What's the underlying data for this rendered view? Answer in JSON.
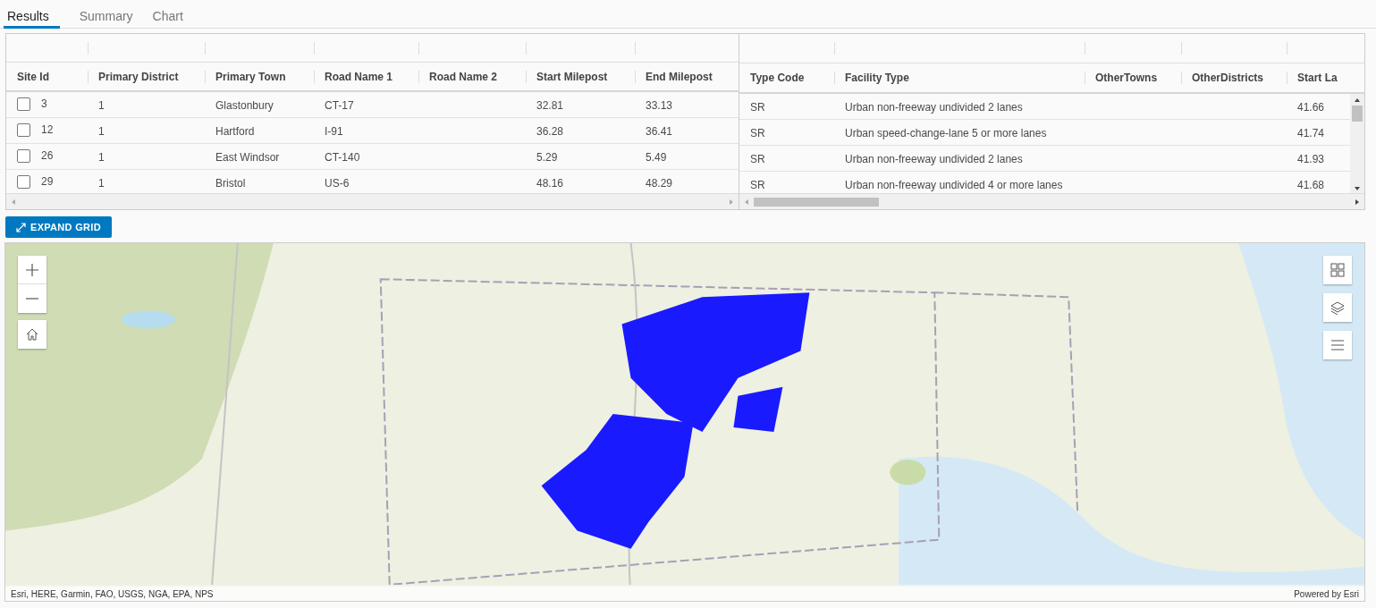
{
  "tabs": [
    {
      "label": "Results",
      "selected": true
    },
    {
      "label": "Summary",
      "selected": false
    },
    {
      "label": "Chart",
      "selected": false
    }
  ],
  "grid": {
    "left_columns": [
      "Site Id",
      "Primary District",
      "Primary Town",
      "Road Name 1",
      "Road Name 2",
      "Start Milepost",
      "End Milepost"
    ],
    "right_columns": [
      "Type Code",
      "Facility Type",
      "OtherTowns",
      "OtherDistricts",
      "Start La"
    ],
    "rows": [
      {
        "checked": false,
        "site_id": "3",
        "primary_district": "1",
        "primary_town": "Glastonbury",
        "road_name_1": "CT-17",
        "start_milepost": "32.81",
        "end_milepost": "33.13",
        "type_code": "SR",
        "facility_type": "Urban non-freeway undivided 2 lanes",
        "start_la": "41.66"
      },
      {
        "checked": false,
        "site_id": "12",
        "primary_district": "1",
        "primary_town": "Hartford",
        "road_name_1": "I-91",
        "start_milepost": "36.28",
        "end_milepost": "36.41",
        "type_code": "SR",
        "facility_type": "Urban speed-change-lane 5 or more lanes",
        "start_la": "41.74"
      },
      {
        "checked": false,
        "site_id": "26",
        "primary_district": "1",
        "primary_town": "East Windsor",
        "road_name_1": "CT-140",
        "start_milepost": "5.29",
        "end_milepost": "5.49",
        "type_code": "SR",
        "facility_type": "Urban non-freeway undivided 2 lanes",
        "start_la": "41.93"
      },
      {
        "checked": false,
        "site_id": "29",
        "primary_district": "1",
        "primary_town": "Bristol",
        "road_name_1": "US-6",
        "start_milepost": "48.16",
        "end_milepost": "48.29",
        "type_code": "SR",
        "facility_type": "Urban non-freeway undivided 4 or more lanes",
        "start_la": "41.68"
      }
    ]
  },
  "expand_button": {
    "label": "EXPAND GRID"
  },
  "map": {
    "kind": "picture",
    "attribution": "Esri, HERE, Garmin, FAO, USGS, NGA, EPA, NPS",
    "powered_by": "Powered by Esri"
  }
}
